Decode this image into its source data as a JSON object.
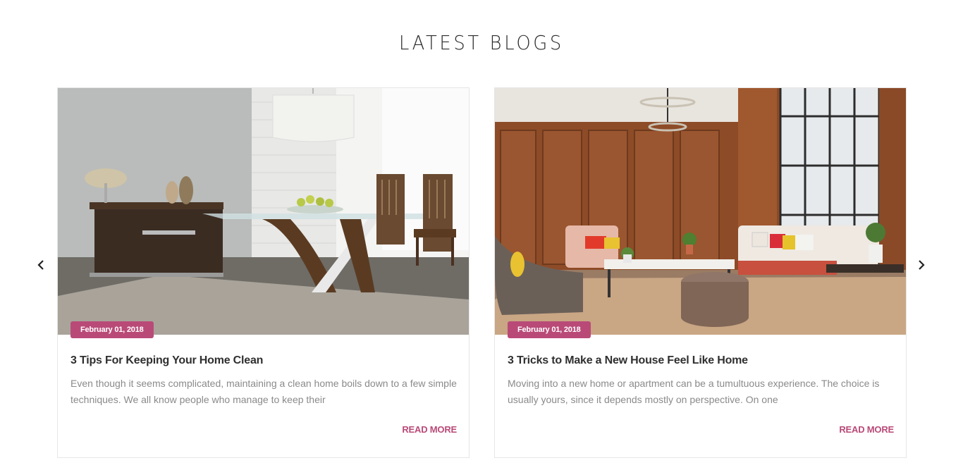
{
  "section": {
    "title": "LATEST BLOGS"
  },
  "nav": {
    "prev_icon": "chevron-left-icon",
    "next_icon": "chevron-right-icon"
  },
  "posts": [
    {
      "date": "February 01, 2018",
      "title": "3 Tips For Keeping Your Home Clean",
      "excerpt": "Even though it seems complicated, maintaining a clean home boils down to a few simple techniques. We all know people who manage to keep their",
      "read_more": "READ MORE",
      "image": "dining-room-photo"
    },
    {
      "date": "February 01, 2018",
      "title": "3 Tricks to Make a New House Feel Like Home",
      "excerpt": "Moving into a new home or apartment can be a tumultuous experience. The choice is usually yours, since it depends mostly on perspective. On one",
      "read_more": "READ MORE",
      "image": "living-room-photo"
    }
  ],
  "colors": {
    "accent": "#b94a78",
    "title": "#2f2f2f",
    "body_text": "#8a8a8a",
    "border": "#e6e6e6"
  }
}
